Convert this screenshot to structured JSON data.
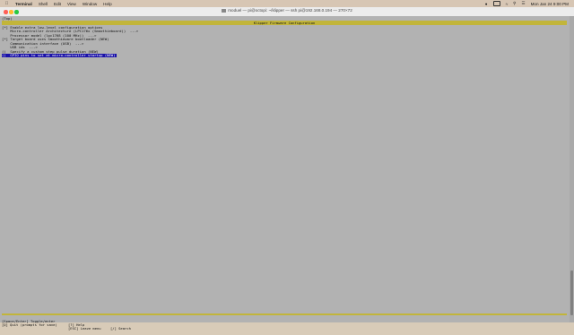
{
  "menubar": {
    "app": "Terminal",
    "items": [
      "Shell",
      "Edit",
      "View",
      "Window",
      "Help"
    ],
    "datetime": "Mon Jan 24  9:00 PM"
  },
  "window": {
    "title": "moduel — pi@octopi: ~/klipper — ssh pi@192.168.0.194 — 270×72"
  },
  "terminal": {
    "path": "(Top)",
    "header": "Klipper Firmware Configuration",
    "menu": [
      "[*] Enable extra low-level configuration options",
      "    Micro-controller Architecture (LPC176x (Smoothieboard))  --->",
      "    Processor model (lpc1768 (100 MHz))  --->",
      "[*] Target board uses Smoothieware bootloader (NEW)",
      "    Communication interface (USB)  --->",
      "    USB ids  --->",
      "()  Specify a custom step pulse duration (NEW)",
      "()  GPIO pins to set at micro-controller startup (NEW)"
    ],
    "selected_index": 7,
    "help": {
      "toggle": "[Space/Enter] Toggle/enter",
      "help": "[?] Help",
      "search": "[/] Search",
      "quit": "[Q] Quit (prompts for save)",
      "esc": "[ESC] Leave menu"
    }
  },
  "colors": {
    "terminal_bg": "#b2b2b2",
    "header_bg": "#c2b53a",
    "selection_bg": "#1a12a8"
  }
}
